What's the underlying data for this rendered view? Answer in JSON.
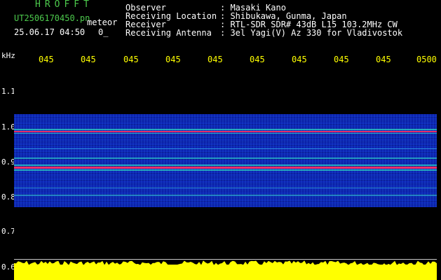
{
  "header": {
    "brand": "HROFFT",
    "filename": "UT2506170450.pn",
    "filename_suffix": "meteor",
    "timestamp": "25.06.17 04:50",
    "timestamp_extra": "0_"
  },
  "info": [
    {
      "label": "Observer",
      "value": ": Masaki Kano"
    },
    {
      "label": "Receiving Location",
      "value": ": Shibukawa, Gunma, Japan"
    },
    {
      "label": "Receiver",
      "value": ": RTL-SDR SDR# 43dB L15 103.2MHz CW"
    },
    {
      "label": "Receiving Antenna",
      "value": ": 3el Yagi(V) Az 330 for Vladivostok"
    }
  ],
  "axis": {
    "unit": "kHz",
    "time_ticks": [
      "045",
      "045",
      "045",
      "045",
      "045",
      "045",
      "045",
      "045",
      "045",
      "0500"
    ],
    "freq_ticks": [
      "1.1",
      "1.0",
      "0.9",
      "0.8",
      "0.7",
      "0.6"
    ]
  },
  "colors": {
    "header_green": "#4cc94c",
    "tick_yellow": "#ffff00",
    "signal_red": "#ff3060",
    "signal_cyan": "#30e0c0",
    "waterfall_blue": "#0a23c8"
  }
}
